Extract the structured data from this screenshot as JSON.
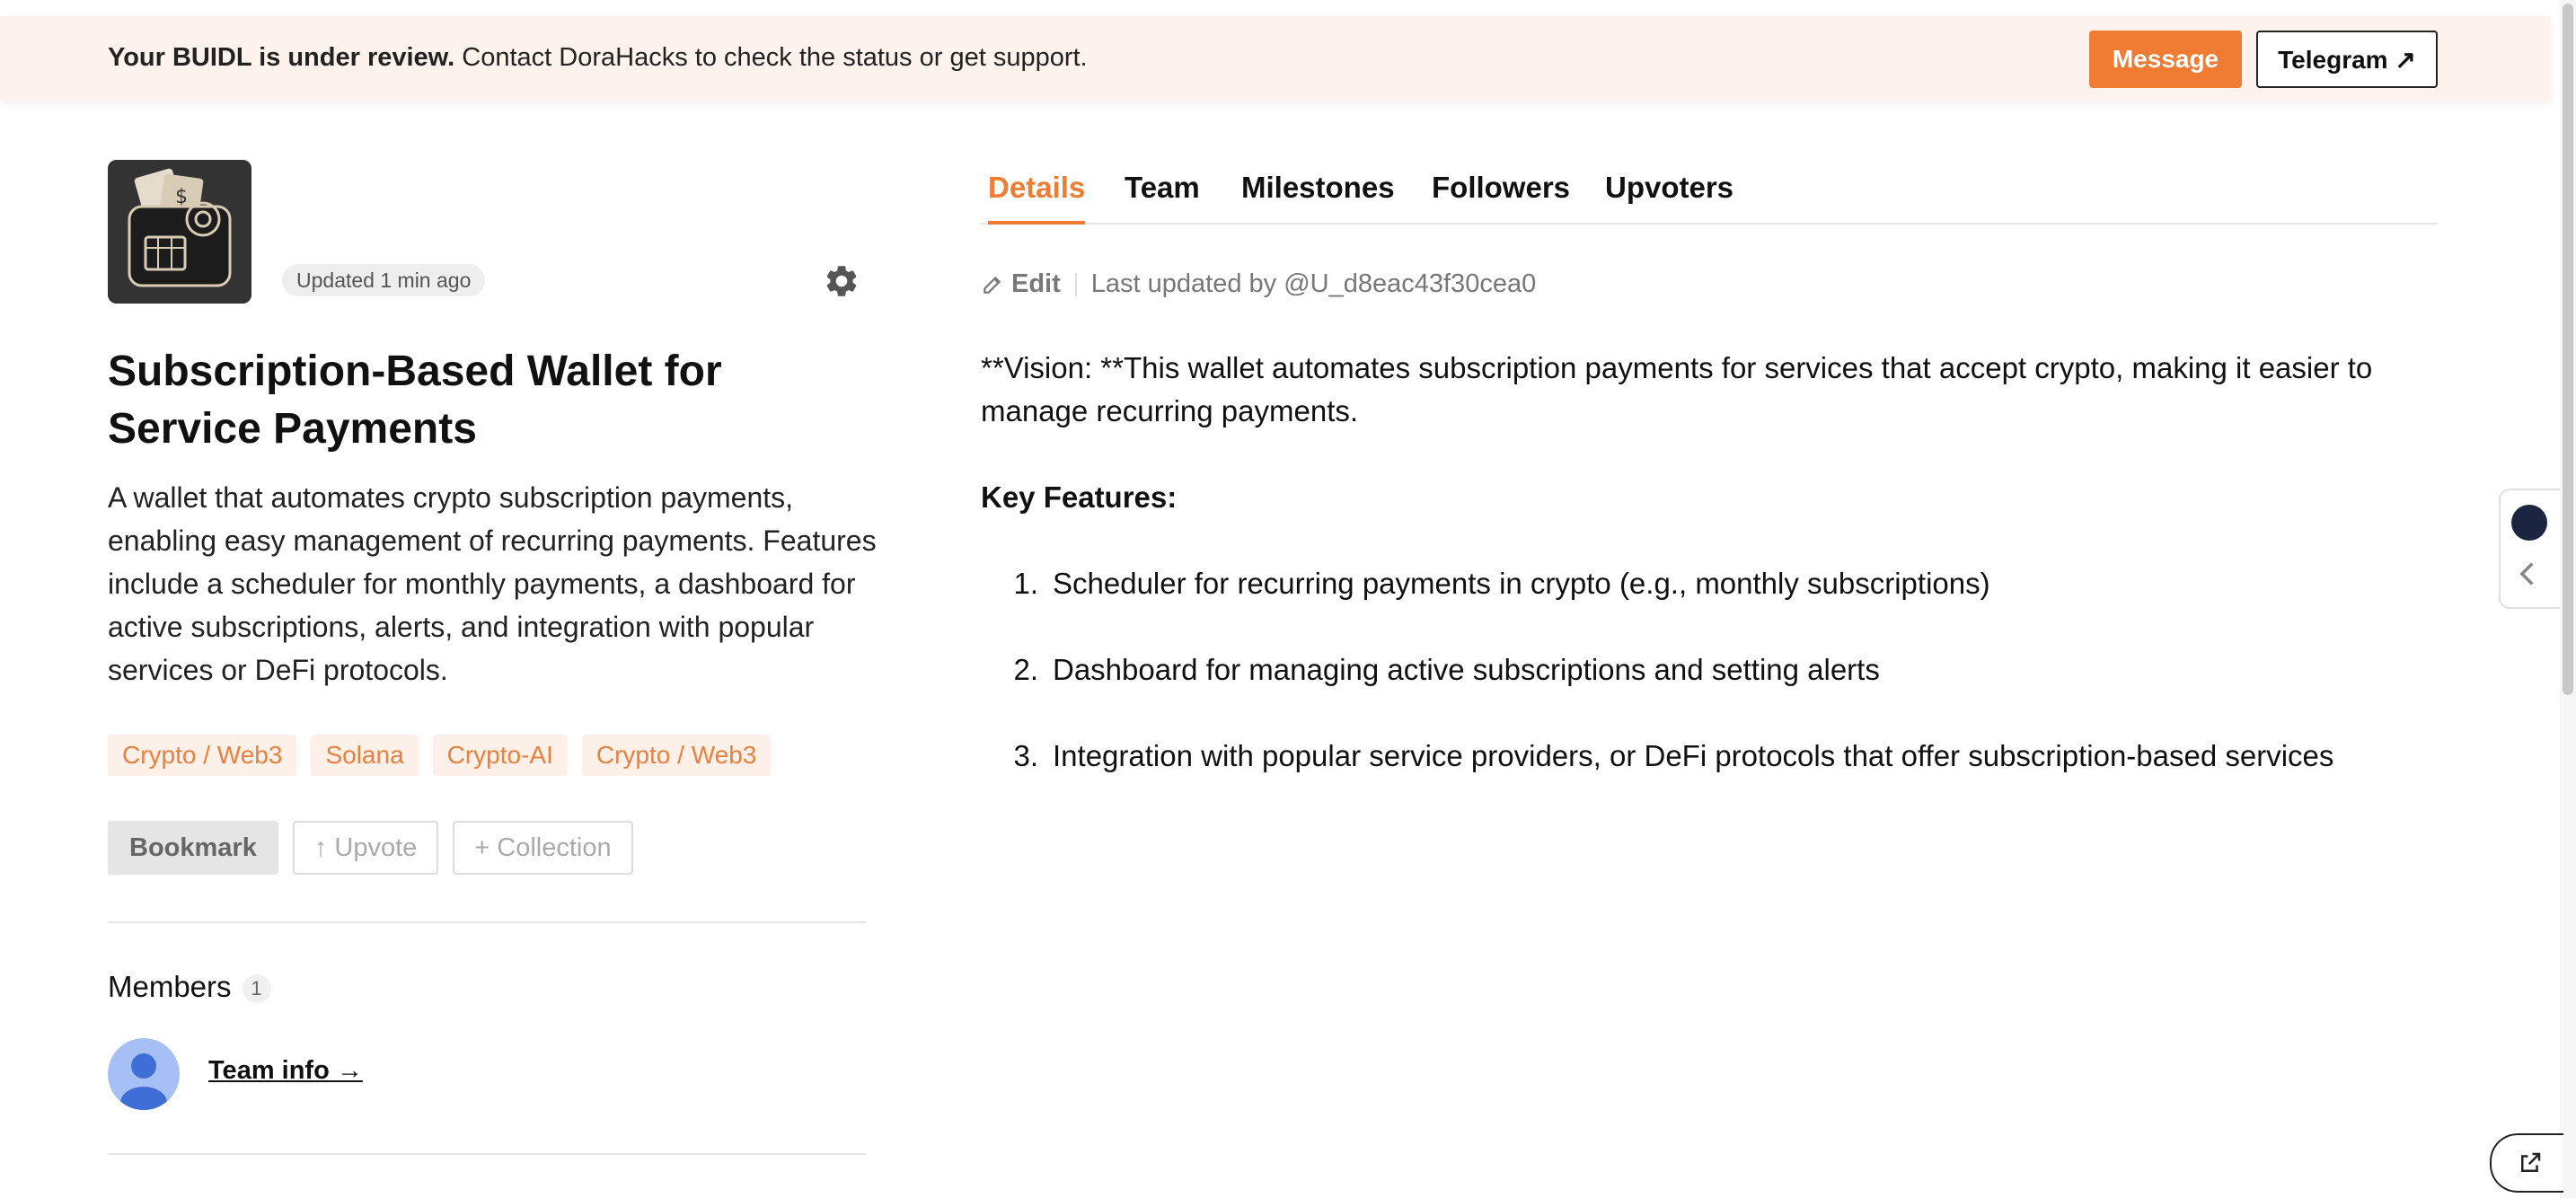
{
  "banner": {
    "bold_text": "Your BUIDL is under review.",
    "text": " Contact DoraHacks to check the status or get support.",
    "message_label": "Message",
    "telegram_label": "Telegram ↗"
  },
  "project": {
    "updated": "Updated 1 min ago",
    "title": "Subscription-Based Wallet for Service Payments",
    "description": "A wallet that automates crypto subscription payments, enabling easy management of recurring payments. Features include a scheduler for monthly payments, a dashboard for active subscriptions, alerts, and integration with popular services or DeFi protocols.",
    "tags": [
      "Crypto / Web3",
      "Solana",
      "Crypto-AI",
      "Crypto / Web3"
    ],
    "actions": {
      "bookmark": "Bookmark",
      "upvote": "↑ Upvote",
      "collection": "+ Collection"
    }
  },
  "members": {
    "title": "Members",
    "count": "1",
    "team_link": "Team info →"
  },
  "tabs": [
    {
      "label": "Details",
      "active": true
    },
    {
      "label": "Team",
      "active": false
    },
    {
      "label": "Milestones",
      "active": false
    },
    {
      "label": "Followers",
      "active": false
    },
    {
      "label": "Upvoters",
      "active": false
    }
  ],
  "details": {
    "edit_label": "Edit",
    "last_updated": "Last updated by @U_d8eac43f30cea0",
    "vision": "**Vision: **This wallet automates subscription payments for services that accept crypto, making it easier to manage recurring payments.",
    "key_features_heading": "Key Features:",
    "features": [
      {
        "num": "1.",
        "text": "Scheduler for recurring payments in crypto (e.g., monthly subscriptions)"
      },
      {
        "num": "2.",
        "text": "Dashboard for managing active subscriptions and setting alerts"
      },
      {
        "num": "3.",
        "text": "Integration with popular service providers, or DeFi protocols that offer subscription-based services"
      }
    ]
  },
  "colors": {
    "accent": "#f07b33",
    "banner_bg": "#fdf2ec",
    "tag_bg": "#fdf0e8",
    "tag_text": "#e8803f"
  },
  "icons": {
    "settings": "gear-icon",
    "edit": "pencil-icon",
    "avatar": "user-avatar-icon",
    "side_panel": "chevron-left-icon",
    "share": "share-icon"
  }
}
